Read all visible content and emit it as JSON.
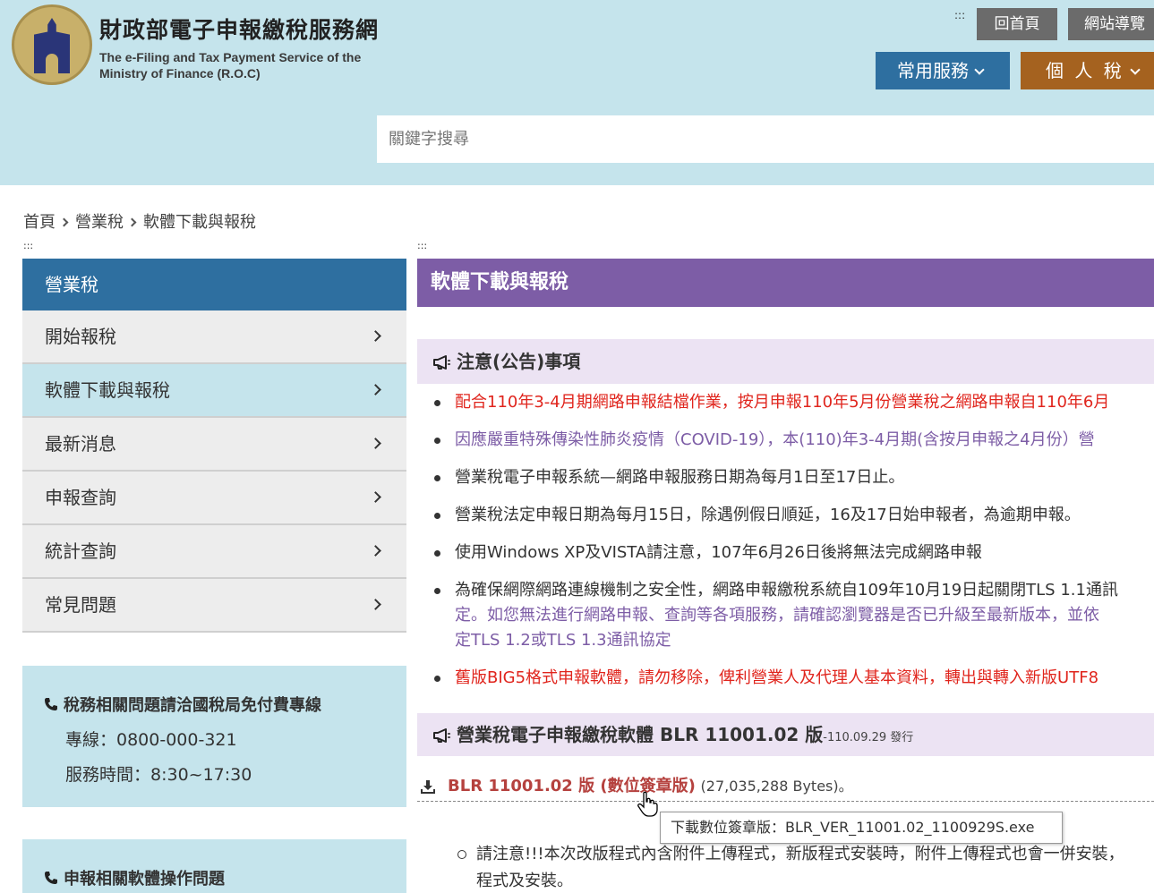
{
  "header": {
    "title_zh": "財政部電子申報繳稅服務網",
    "title_en_line1": "The e-Filing and Tax Payment Service of the",
    "title_en_line2": "Ministry of Finance (R.O.C)",
    "accesskey_top": ":::",
    "home_label": "回首頁",
    "sitemap_label": "網站導覽",
    "service_label": "常用服務",
    "tax_label": "個 人 稅",
    "search_placeholder": "關鍵字搜尋"
  },
  "breadcrumb": {
    "items": [
      "首頁",
      "營業稅",
      "軟體下載與報稅"
    ]
  },
  "accesskey": {
    "left": ":::",
    "main": ":::"
  },
  "sidebar": {
    "title": "營業稅",
    "items": [
      {
        "label": "開始報稅"
      },
      {
        "label": "軟體下載與報稅"
      },
      {
        "label": "最新消息"
      },
      {
        "label": "申報查詢"
      },
      {
        "label": "統計查詢"
      },
      {
        "label": "常見問題"
      }
    ],
    "info1": {
      "title": "稅務相關問題請洽國稅局免付費專線",
      "line1": "專線：0800-000-321",
      "line2": "服務時間：8:30~17:30"
    },
    "info2": {
      "title": "申報相關軟體操作問題"
    }
  },
  "main": {
    "title": "軟體下載與報稅",
    "notice_title": "注意(公告)事項",
    "notices": [
      "配合110年3-4月期網路申報結檔作業，按月申報110年5月份營業稅之網路申報自110年6月",
      "因應嚴重特殊傳染性肺炎疫情（COVID-19），本(110)年3-4月期(含按月申報之4月份）營",
      "營業稅電子申報系統—網路申報服務日期為每月1日至17日止。",
      "營業稅法定申報日期為每月15日，除遇例假日順延，16及17日始申報者，為逾期申報。",
      "使用Windows XP及VISTA請注意，107年6月26日後將無法完成網路申報"
    ],
    "tls_notice_line1": "為確保網際網路連線機制之安全性，網路申報繳稅系統自109年10月19日起關閉TLS 1.1通訊",
    "tls_notice_line2": "定。如您無法進行網路申報、查詢等各項服務，請確認瀏覽器是否已升級至最新版本，並依",
    "tls_notice_line3": "定TLS 1.2或TLS 1.3通訊協定",
    "big5_notice": "舊版BIG5格式申報軟體，請勿移除，俾利營業人及代理人基本資料，轉出與轉入新版UTF8",
    "software_title": "營業稅電子申報繳稅軟體 BLR 11001.02 版",
    "software_date": "-110.09.29 發行",
    "download_link": "BLR 11001.02 版 (數位簽章版)",
    "download_size": "(27,035,288 Bytes)。",
    "tooltip": "下載數位簽章版：BLR_VER_11001.02_1100929S.exe",
    "sub_notice_line1": "請注意!!!本次改版程式內含附件上傳程式，新版程式安裝時，附件上傳程式也會一併安裝，",
    "sub_notice_line2": "程式及安裝。"
  },
  "colors": {
    "header_bg": "#c5e4ec",
    "service_blue": "#2e6fa0",
    "tax_brown": "#a5621f",
    "main_purple": "#7d5da6",
    "notice_red": "#e0251d",
    "link_red": "#b5413e"
  }
}
